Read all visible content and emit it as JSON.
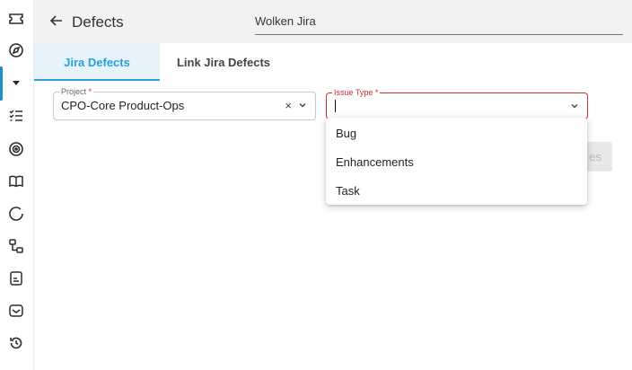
{
  "sidebar": {
    "items": [
      {
        "icon": "ticket-icon"
      },
      {
        "icon": "compass-icon"
      },
      {
        "icon": "caret-down-icon",
        "active": true
      },
      {
        "icon": "checklist-icon"
      },
      {
        "icon": "target-icon"
      },
      {
        "icon": "book-icon"
      },
      {
        "icon": "circle-icon"
      },
      {
        "icon": "hierarchy-icon"
      },
      {
        "icon": "document-icon"
      },
      {
        "icon": "inbox-icon"
      },
      {
        "icon": "history-icon"
      }
    ],
    "accent": "#1e90c8"
  },
  "header": {
    "title": "Defects",
    "app_name": "Wolken Jira"
  },
  "tabs": [
    {
      "label": "Jira Defects",
      "active": true
    },
    {
      "label": "Link Jira Defects",
      "active": false
    }
  ],
  "form": {
    "project": {
      "label": "Project",
      "required_mark": "*",
      "value": "CPO-Core Product-Ops",
      "clear_glyph": "×"
    },
    "issue_type": {
      "label": "Issue Type",
      "required_mark": "*",
      "value": "",
      "error_color": "#d32f2f"
    }
  },
  "partial_button": {
    "label": "es"
  },
  "dropdown": {
    "options": [
      "Bug",
      "Enhancements",
      "Task"
    ]
  },
  "colors": {
    "tab_active_text": "#2aa0d8",
    "tab_active_bg": "#e6f3fa",
    "header_bg": "#f2f2f2"
  }
}
